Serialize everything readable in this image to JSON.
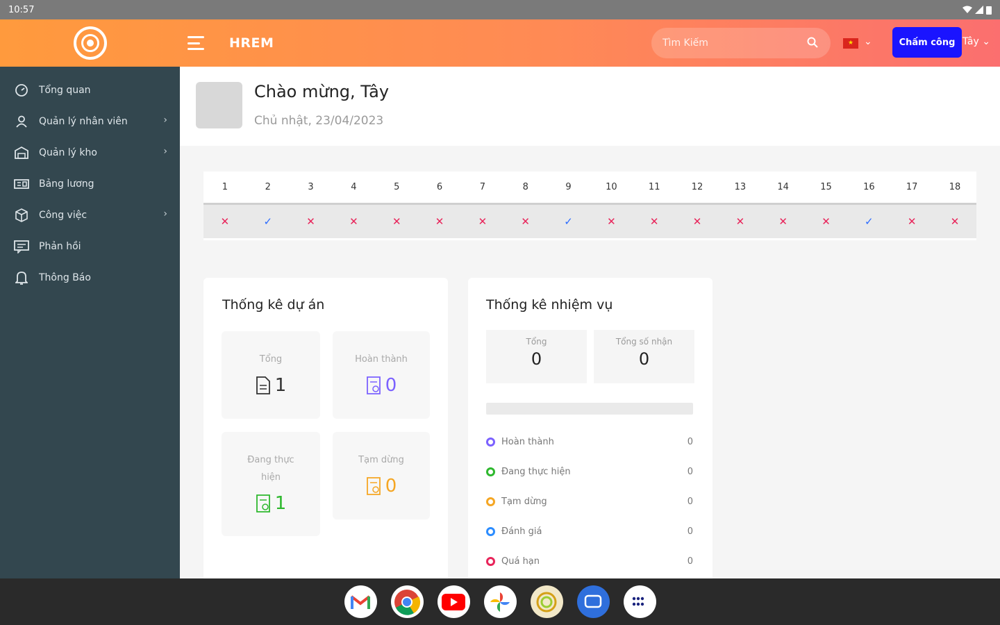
{
  "status_bar": {
    "time": "10:57"
  },
  "header": {
    "brand": "HREM",
    "search_placeholder": "Tìm Kiếm",
    "checkin_label": "Chấm công",
    "user_name": "Tây"
  },
  "sidebar": {
    "items": [
      {
        "label": "Tổng quan",
        "icon": "dashboard-icon",
        "has_submenu": false
      },
      {
        "label": "Quản lý nhân viên",
        "icon": "user-icon",
        "has_submenu": true
      },
      {
        "label": "Quản lý kho",
        "icon": "warehouse-icon",
        "has_submenu": true
      },
      {
        "label": "Bảng lương",
        "icon": "payroll-icon",
        "has_submenu": false
      },
      {
        "label": "Công việc",
        "icon": "cube-icon",
        "has_submenu": true
      },
      {
        "label": "Phản hồi",
        "icon": "feedback-icon",
        "has_submenu": false
      },
      {
        "label": "Thông Báo",
        "icon": "bell-icon",
        "has_submenu": false
      }
    ]
  },
  "welcome": {
    "greeting": "Chào mừng, Tây",
    "date": "Chủ nhật, 23/04/2023"
  },
  "attendance": {
    "days": [
      "1",
      "2",
      "3",
      "4",
      "5",
      "6",
      "7",
      "8",
      "9",
      "10",
      "11",
      "12",
      "13",
      "14",
      "15",
      "16",
      "17",
      "18"
    ],
    "marks": [
      "x",
      "check",
      "x",
      "x",
      "x",
      "x",
      "x",
      "x",
      "check",
      "x",
      "x",
      "x",
      "x",
      "x",
      "x",
      "check",
      "x",
      "x"
    ]
  },
  "project_stats": {
    "title": "Thống kê dự án",
    "tiles": [
      {
        "label": "Tổng",
        "value": "1",
        "color": "#333333"
      },
      {
        "label": "Hoàn thành",
        "value": "0",
        "color": "#7b61ff"
      },
      {
        "label": "Đang thực hiện",
        "value": "1",
        "color": "#2eb82e"
      },
      {
        "label": "Tạm dừng",
        "value": "0",
        "color": "#f5a623"
      }
    ]
  },
  "task_stats": {
    "title": "Thống kê nhiệm vụ",
    "boxes": [
      {
        "label": "Tổng",
        "value": "0"
      },
      {
        "label": "Tổng số nhận",
        "value": "0"
      }
    ],
    "legend": [
      {
        "label": "Hoàn thành",
        "value": "0",
        "color": "#7b61ff"
      },
      {
        "label": "Đang thực hiện",
        "value": "0",
        "color": "#2eb82e"
      },
      {
        "label": "Tạm dừng",
        "value": "0",
        "color": "#f5a623"
      },
      {
        "label": "Đánh giá",
        "value": "0",
        "color": "#2b8cff"
      },
      {
        "label": "Quá hạn",
        "value": "0",
        "color": "#e8245a"
      }
    ]
  },
  "taskbar": {
    "apps": [
      "gmail-icon",
      "chrome-icon",
      "youtube-icon",
      "photos-icon",
      "hrem-app-icon",
      "messages-icon",
      "app-drawer-icon"
    ]
  }
}
